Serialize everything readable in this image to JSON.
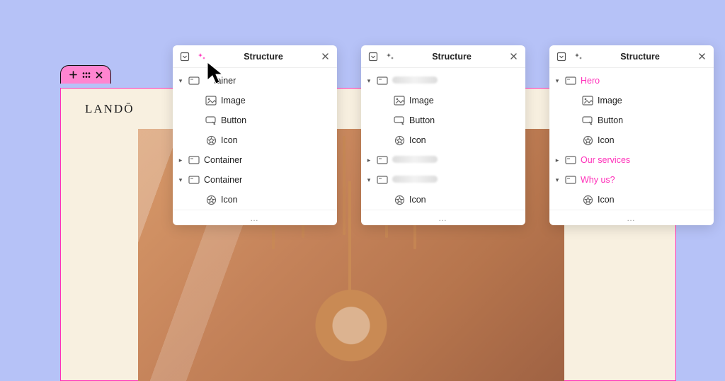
{
  "canvas": {
    "brand": "LANDŌ"
  },
  "tab": {
    "icons": [
      "plus-icon",
      "drag-dots-icon",
      "close-icon"
    ]
  },
  "panels": [
    {
      "title": "Structure",
      "footer": "…",
      "sparkle_pink": true,
      "items": [
        {
          "caret": "down",
          "depth": 0,
          "icon": "container-icon",
          "label": "Container",
          "blurred": false,
          "pink": false,
          "obscured_prefix": true
        },
        {
          "caret": "blank",
          "depth": 1,
          "icon": "image-icon",
          "label": "Image",
          "blurred": false,
          "pink": false
        },
        {
          "caret": "blank",
          "depth": 1,
          "icon": "button-icon",
          "label": "Button",
          "blurred": false,
          "pink": false
        },
        {
          "caret": "blank",
          "depth": 1,
          "icon": "icon-icon",
          "label": "Icon",
          "blurred": false,
          "pink": false
        },
        {
          "caret": "right",
          "depth": 0,
          "icon": "container-icon",
          "label": "Container",
          "blurred": false,
          "pink": false
        },
        {
          "caret": "down",
          "depth": 0,
          "icon": "container-icon",
          "label": "Container",
          "blurred": false,
          "pink": false
        },
        {
          "caret": "blank",
          "depth": 1,
          "icon": "icon-icon",
          "label": "Icon",
          "blurred": false,
          "pink": false
        }
      ]
    },
    {
      "title": "Structure",
      "footer": "…",
      "sparkle_pink": false,
      "items": [
        {
          "caret": "down",
          "depth": 0,
          "icon": "container-icon",
          "label": "",
          "blurred": true,
          "pink": false
        },
        {
          "caret": "blank",
          "depth": 1,
          "icon": "image-icon",
          "label": "Image",
          "blurred": false,
          "pink": false
        },
        {
          "caret": "blank",
          "depth": 1,
          "icon": "button-icon",
          "label": "Button",
          "blurred": false,
          "pink": false
        },
        {
          "caret": "blank",
          "depth": 1,
          "icon": "icon-icon",
          "label": "Icon",
          "blurred": false,
          "pink": false
        },
        {
          "caret": "right",
          "depth": 0,
          "icon": "container-icon",
          "label": "",
          "blurred": true,
          "pink": false
        },
        {
          "caret": "down",
          "depth": 0,
          "icon": "container-icon",
          "label": "",
          "blurred": true,
          "pink": false
        },
        {
          "caret": "blank",
          "depth": 1,
          "icon": "icon-icon",
          "label": "Icon",
          "blurred": false,
          "pink": false
        }
      ]
    },
    {
      "title": "Structure",
      "footer": "…",
      "sparkle_pink": false,
      "items": [
        {
          "caret": "down",
          "depth": 0,
          "icon": "container-icon",
          "label": "Hero",
          "blurred": false,
          "pink": true
        },
        {
          "caret": "blank",
          "depth": 1,
          "icon": "image-icon",
          "label": "Image",
          "blurred": false,
          "pink": false
        },
        {
          "caret": "blank",
          "depth": 1,
          "icon": "button-icon",
          "label": "Button",
          "blurred": false,
          "pink": false
        },
        {
          "caret": "blank",
          "depth": 1,
          "icon": "icon-icon",
          "label": "Icon",
          "blurred": false,
          "pink": false
        },
        {
          "caret": "right",
          "depth": 0,
          "icon": "container-icon",
          "label": "Our services",
          "blurred": false,
          "pink": true
        },
        {
          "caret": "down",
          "depth": 0,
          "icon": "container-icon",
          "label": "Why us?",
          "blurred": false,
          "pink": true
        },
        {
          "caret": "blank",
          "depth": 1,
          "icon": "icon-icon",
          "label": "Icon",
          "blurred": false,
          "pink": false
        }
      ]
    }
  ]
}
